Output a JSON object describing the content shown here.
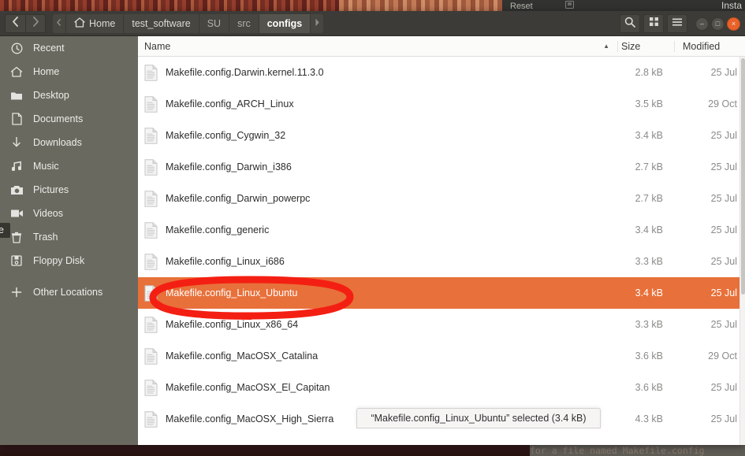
{
  "window": {
    "title": "configs",
    "accent_selected": "#e8703a",
    "sidebar_bg": "#6a695f",
    "header_bg": "#3c3b37",
    "annotation_color": "#f41f13"
  },
  "background": {
    "top_window_label": "Reset",
    "top_window_icon": "image-icon",
    "install_label": "Insta",
    "terminal_text": "for a file named Makefile.config"
  },
  "header": {
    "back_icon": "chevron-left-icon",
    "forward_icon": "chevron-right-icon",
    "crumb_overflow_icon": "chevron-left-small-icon",
    "crumb_next_icon": "chevron-right-small-icon",
    "breadcrumbs": [
      {
        "label": "Home",
        "icon": "home-icon",
        "active": false
      },
      {
        "label": "test_software",
        "icon": "",
        "active": false
      },
      {
        "label": "SU",
        "icon": "",
        "active": false
      },
      {
        "label": "src",
        "icon": "",
        "active": false
      },
      {
        "label": "configs",
        "icon": "",
        "active": true
      }
    ],
    "actions": [
      {
        "name": "search-button",
        "icon": "search-icon"
      },
      {
        "name": "view-grid-button",
        "icon": "grid-icon"
      },
      {
        "name": "menu-button",
        "icon": "hamburger-icon"
      }
    ],
    "window_controls": [
      {
        "name": "minimize-button",
        "glyph": "–"
      },
      {
        "name": "maximize-button",
        "glyph": "□"
      },
      {
        "name": "close-button",
        "glyph": "×"
      }
    ]
  },
  "sidebar": {
    "items": [
      {
        "label": "Recent",
        "icon": "clock-icon"
      },
      {
        "label": "Home",
        "icon": "home-icon"
      },
      {
        "label": "Desktop",
        "icon": "folder-icon"
      },
      {
        "label": "Documents",
        "icon": "document-icon"
      },
      {
        "label": "Downloads",
        "icon": "download-icon"
      },
      {
        "label": "Music",
        "icon": "music-icon"
      },
      {
        "label": "Pictures",
        "icon": "camera-icon"
      },
      {
        "label": "Videos",
        "icon": "video-icon"
      },
      {
        "label": "Trash",
        "icon": "trash-icon"
      },
      {
        "label": "Floppy Disk",
        "icon": "floppy-icon"
      },
      {
        "label": "Other Locations",
        "icon": "plus-icon"
      }
    ],
    "tooltip": "oftware"
  },
  "filelist": {
    "columns": [
      "Name",
      "Size",
      "Modified"
    ],
    "sort_column": "Name",
    "sort_direction": "ascending",
    "sort_glyph": "▲",
    "rows": [
      {
        "name": "Makefile.config.Darwin.kernel.11.3.0",
        "size": "2.8 kB",
        "modified": "25 Jul",
        "selected": false
      },
      {
        "name": "Makefile.config_ARCH_Linux",
        "size": "3.5 kB",
        "modified": "29 Oct",
        "selected": false
      },
      {
        "name": "Makefile.config_Cygwin_32",
        "size": "3.4 kB",
        "modified": "25 Jul",
        "selected": false
      },
      {
        "name": "Makefile.config_Darwin_i386",
        "size": "2.7 kB",
        "modified": "25 Jul",
        "selected": false
      },
      {
        "name": "Makefile.config_Darwin_powerpc",
        "size": "2.7 kB",
        "modified": "25 Jul",
        "selected": false
      },
      {
        "name": "Makefile.config_generic",
        "size": "3.4 kB",
        "modified": "25 Jul",
        "selected": false
      },
      {
        "name": "Makefile.config_Linux_i686",
        "size": "3.3 kB",
        "modified": "25 Jul",
        "selected": false
      },
      {
        "name": "Makefile.config_Linux_Ubuntu",
        "size": "3.4 kB",
        "modified": "25 Jul",
        "selected": true
      },
      {
        "name": "Makefile.config_Linux_x86_64",
        "size": "3.3 kB",
        "modified": "25 Jul",
        "selected": false
      },
      {
        "name": "Makefile.config_MacOSX_Catalina",
        "size": "3.6 kB",
        "modified": "29 Oct",
        "selected": false
      },
      {
        "name": "Makefile.config_MacOSX_El_Capitan",
        "size": "3.6 kB",
        "modified": "25 Jul",
        "selected": false
      },
      {
        "name": "Makefile.config_MacOSX_High_Sierra",
        "size": "4.3 kB",
        "modified": "25 Jul",
        "selected": false
      }
    ]
  },
  "status": {
    "text": "“Makefile.config_Linux_Ubuntu” selected  (3.4 kB)"
  },
  "annotation": {
    "shape": "ellipse",
    "target": "Makefile.config_Linux_Ubuntu"
  }
}
